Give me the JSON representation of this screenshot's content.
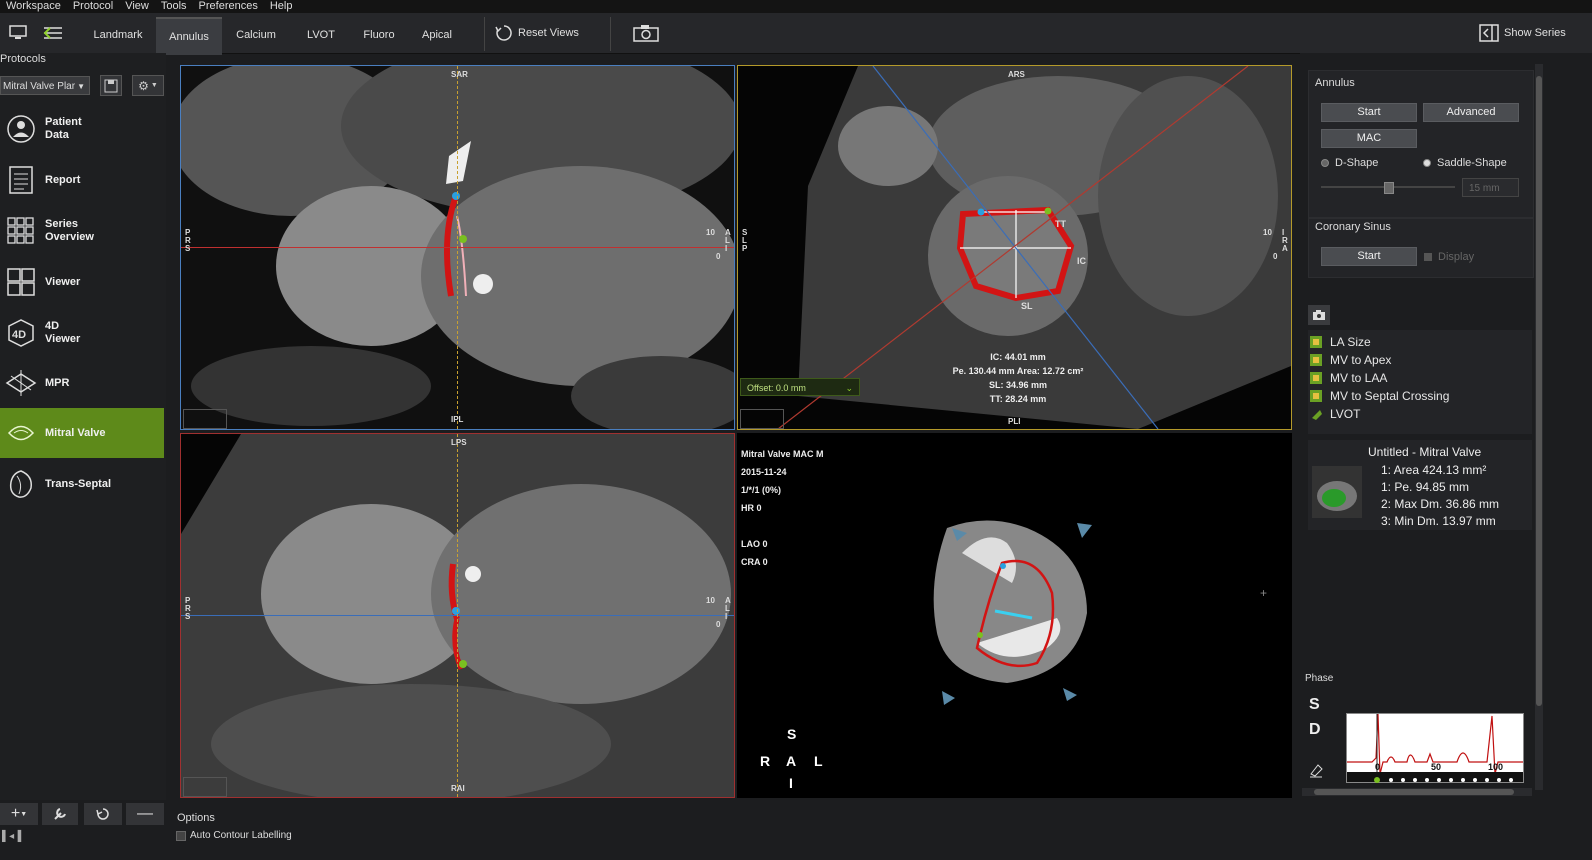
{
  "menu": [
    "Workspace",
    "Protocol",
    "View",
    "Tools",
    "Preferences",
    "Help"
  ],
  "toolbar": {
    "tabs": [
      "Landmark",
      "Annulus",
      "Calcium",
      "LVOT",
      "Fluoro",
      "Apical"
    ],
    "active_tab": "Annulus",
    "reset_views": "Reset Views",
    "show_series": "Show Series"
  },
  "left": {
    "protocols_label": "Protocols",
    "protocol_select": "Mitral Valve Plar",
    "nav": [
      {
        "label": "Patient\nData",
        "icon": "patient-icon"
      },
      {
        "label": "Report",
        "icon": "report-icon"
      },
      {
        "label": "Series\nOverview",
        "icon": "series-overview-icon"
      },
      {
        "label": "Viewer",
        "icon": "viewer-icon"
      },
      {
        "label": "4D\nViewer",
        "icon": "4d-viewer-icon"
      },
      {
        "label": "MPR",
        "icon": "mpr-icon"
      },
      {
        "label": "Mitral Valve",
        "icon": "mitral-valve-icon"
      },
      {
        "label": "Trans-Septal",
        "icon": "trans-septal-icon"
      }
    ],
    "active_nav": "Mitral Valve"
  },
  "viewports": {
    "tl": {
      "top": "SAR",
      "bottom": "IPL",
      "left": "P\nR\nS",
      "right": "A\nL\nI",
      "scale": "10",
      "zero": "0"
    },
    "tr": {
      "top": "ARS",
      "bottom": "PLI",
      "left": "S\nL\nP",
      "right": "I\nR\nA",
      "scale": "10",
      "zero": "0",
      "offset": "Offset: 0.0 mm",
      "labels": {
        "tt": "TT",
        "ic": "IC",
        "sl": "SL"
      },
      "measurements": [
        "IC: 44.01 mm",
        "Pe. 130.44 mm Area: 12.72 cm²",
        "SL: 34.96 mm",
        "TT: 28.24 mm"
      ]
    },
    "bl": {
      "top": "LPS",
      "bottom": "RAI",
      "left": "P\nR\nS",
      "right": "A\nL\nI",
      "scale": "10",
      "zero": "0"
    },
    "br": {
      "info": [
        "Mitral Valve MAC  M",
        "2015-11-24",
        "1/*/1 (0%)",
        "HR 0",
        "",
        "LAO 0",
        "CRA 0"
      ],
      "orient": {
        "s": "S",
        "r": "R",
        "a": "A",
        "l": "L",
        "i": "I"
      }
    }
  },
  "right": {
    "annulus_label": "Annulus",
    "start": "Start",
    "advanced": "Advanced",
    "mac": "MAC",
    "d_shape": "D-Shape",
    "saddle_shape": "Saddle-Shape",
    "slider_value": "15 mm",
    "coronary_label": "Coronary Sinus",
    "cs_start": "Start",
    "display": "Display",
    "list": [
      "LA Size",
      "MV to Apex",
      "MV to LAA",
      "MV to Septal Crossing",
      "LVOT"
    ],
    "summary_title": "Untitled - Mitral Valve",
    "summary": [
      "1: Area 424.13 mm²",
      "1: Pe. 94.85 mm",
      "2: Max Dm. 36.86 mm",
      "3: Min Dm. 13.97 mm"
    ],
    "phase_label": "Phase",
    "phase_s": "S",
    "phase_d": "D",
    "phase_ticks": [
      "0",
      "50",
      "100"
    ]
  },
  "bottom": {
    "options": "Options",
    "auto_contour": "Auto Contour Labelling"
  },
  "colors": {
    "accent": "#5e8a1a",
    "red": "#d21414",
    "blue_border": "#4a7fc0",
    "yellow_border": "#b49a2a",
    "red_border": "#a03030"
  }
}
